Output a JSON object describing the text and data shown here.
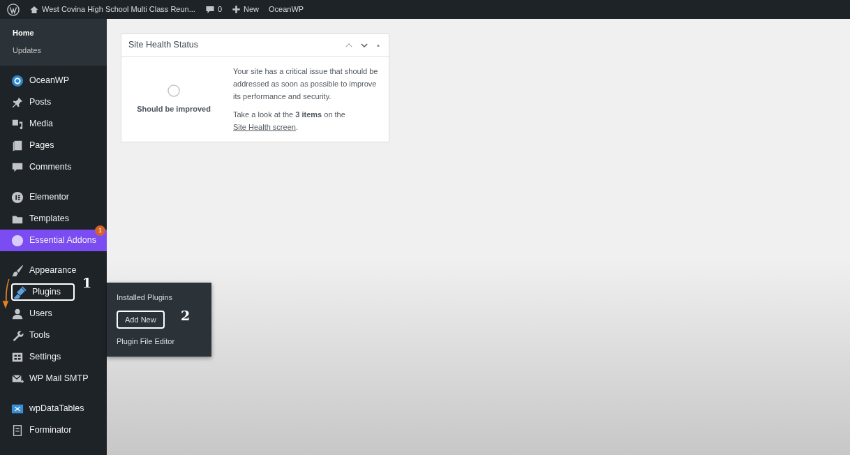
{
  "admin_bar": {
    "site_title": "West Covina High School Multi Class Reun...",
    "comments_count": "0",
    "new_label": "New",
    "theme_label": "OceanWP"
  },
  "sidebar": {
    "submenu": [
      {
        "label": "Home",
        "selected": true
      },
      {
        "label": "Updates",
        "selected": false
      }
    ],
    "groups": [
      [
        {
          "label": "OceanWP",
          "highlighted": false,
          "outlined": false
        },
        {
          "label": "Posts",
          "highlighted": false,
          "outlined": false
        },
        {
          "label": "Media",
          "highlighted": false,
          "outlined": false
        },
        {
          "label": "Pages",
          "highlighted": false,
          "outlined": false
        },
        {
          "label": "Comments",
          "highlighted": false,
          "outlined": false
        }
      ],
      [
        {
          "label": "Elementor",
          "highlighted": false,
          "outlined": false
        },
        {
          "label": "Templates",
          "highlighted": false,
          "outlined": false
        },
        {
          "label": "Essential Addons",
          "highlighted": true,
          "outlined": false,
          "badge": "1"
        }
      ],
      [
        {
          "label": "Appearance",
          "highlighted": false,
          "outlined": false
        },
        {
          "label": "Plugins",
          "highlighted": false,
          "outlined": true,
          "step": "1"
        },
        {
          "label": "Users",
          "highlighted": false,
          "outlined": false
        },
        {
          "label": "Tools",
          "highlighted": false,
          "outlined": false
        },
        {
          "label": "Settings",
          "highlighted": false,
          "outlined": false
        },
        {
          "label": "WP Mail SMTP",
          "highlighted": false,
          "outlined": false
        }
      ],
      [
        {
          "label": "wpDataTables",
          "highlighted": false,
          "outlined": false
        },
        {
          "label": "Forminator",
          "highlighted": false,
          "outlined": false
        }
      ]
    ]
  },
  "flyout": [
    {
      "label": "Installed Plugins"
    },
    {
      "label": "Add New",
      "step": "2"
    },
    {
      "label": "Plugin File Editor"
    }
  ],
  "site_health": {
    "title": "Site Health Status",
    "status": "Should be improved",
    "message": "Your site has a critical issue that should be addressed as soon as possible to improve its performance and security.",
    "hint": "Take a look at the **3 items** on the",
    "link": "Site Health screen",
    "hint_end": "."
  }
}
